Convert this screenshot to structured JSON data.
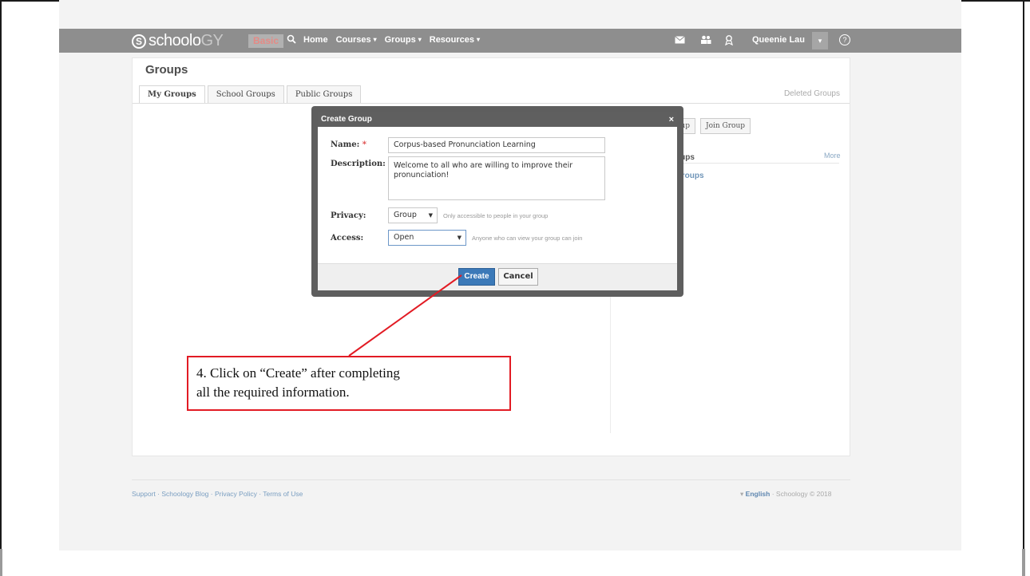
{
  "nav": {
    "logo_mark": "S",
    "logo_text_a": "schoolo",
    "logo_text_b": "GY",
    "plan_badge": "Basic",
    "search_icon": "magnifier-icon",
    "items": [
      {
        "label": "Home",
        "has_caret": false
      },
      {
        "label": "Courses",
        "has_caret": true
      },
      {
        "label": "Groups",
        "has_caret": true
      },
      {
        "label": "Resources",
        "has_caret": true
      }
    ],
    "caret": "▾",
    "user_name": "Queenie Lau",
    "user_menu_caret": "▾",
    "help_glyph": "?"
  },
  "page": {
    "title": "Groups",
    "tabs": [
      "My Groups",
      "School Groups",
      "Public Groups"
    ],
    "deleted_link": "Deleted Groups",
    "side_buttons": [
      "oup",
      "Join Group"
    ],
    "side_heading": "oups",
    "side_more": "More",
    "side_link": "Groups"
  },
  "modal": {
    "title": "Create Group",
    "close": "×",
    "name_label": "Name:",
    "required_mark": "*",
    "name_value": "Corpus-based Pronunciation Learning",
    "description_label": "Description:",
    "description_value": "Welcome to all who are willing to improve their pronunciation!",
    "privacy_label": "Privacy:",
    "privacy_value": "Group",
    "privacy_hint": "Only accessible to people in your group",
    "access_label": "Access:",
    "access_value": "Open",
    "access_hint": "Anyone who can view your group can join",
    "create_label": "Create",
    "cancel_label": "Cancel"
  },
  "footer": {
    "links": "Support · Schoology Blog · Privacy Policy · Terms of Use",
    "lang_caret": "▾",
    "language": "English",
    "copyright": "· Schoology © 2018"
  },
  "callout": {
    "line1": "4. Click on “Create” after completing",
    "line2": "all the required information."
  },
  "colors": {
    "nav_bar": "#8e8e8e",
    "primary_button": "#3b79b8",
    "callout_red": "#e21b24"
  }
}
